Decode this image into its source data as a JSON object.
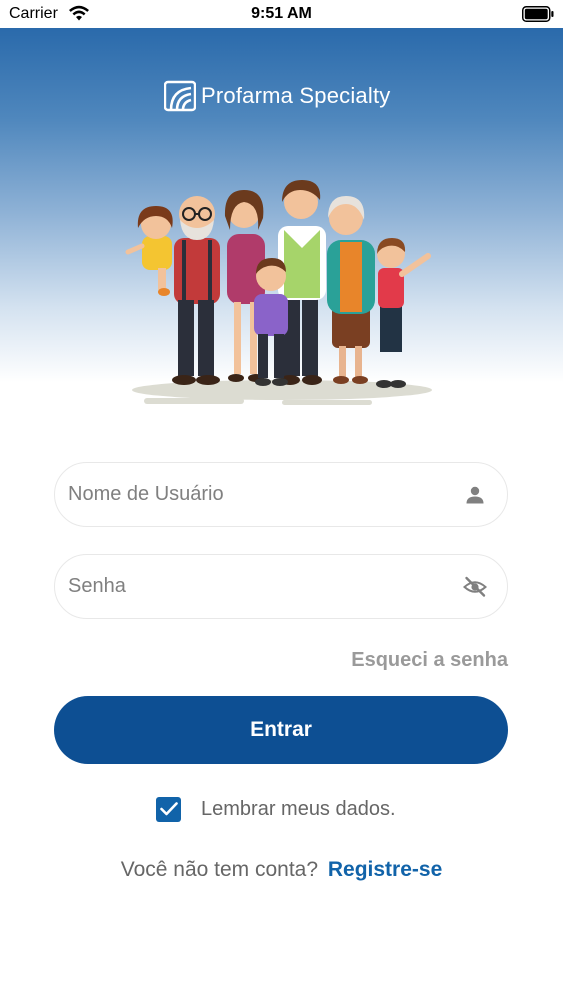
{
  "status_bar": {
    "carrier": "Carrier",
    "time": "9:51 AM"
  },
  "brand": {
    "name": "Profarma Specialty",
    "accent_color": "#0d4f93",
    "link_color": "#1163a9"
  },
  "login_form": {
    "username_placeholder": "Nome de Usuário",
    "username_value": "",
    "username_icon": "user-icon",
    "password_placeholder": "Senha",
    "password_value": "",
    "password_icon": "eye-slash-icon",
    "forgot_password_label": "Esqueci a senha",
    "submit_label": "Entrar",
    "remember_label": "Lembrar meus dados.",
    "remember_checked": true
  },
  "signup": {
    "question": "Você não tem conta?",
    "link_label": "Registre-se"
  }
}
